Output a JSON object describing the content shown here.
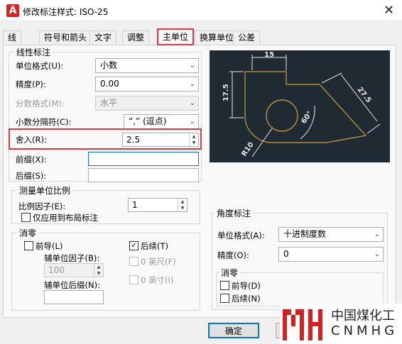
{
  "window": {
    "title": "修改标注样式: ISO-25",
    "app_icon_letter": "A"
  },
  "tabs": [
    "线",
    "符号和箭头",
    "文字",
    "调整",
    "主单位",
    "换算单位",
    "公差"
  ],
  "linear": {
    "group_title": "线性标注",
    "unit_format_label": "单位格式(U):",
    "unit_format_value": "小数",
    "precision_label": "精度(P):",
    "precision_value": "0.00",
    "fraction_format_label": "分数格式(M):",
    "fraction_format_value": "水平",
    "decimal_sep_label": "小数分隔符(C):",
    "decimal_sep_value": "“,” (逗点)",
    "round_off_label": "舍入(R):",
    "round_off_value": "2.5",
    "prefix_label": "前缀(X):",
    "prefix_value": "",
    "suffix_label": "后缀(S):",
    "suffix_value": ""
  },
  "scale": {
    "group_title": "测量单位比例",
    "factor_label": "比例因子(E):",
    "factor_value": "1",
    "layout_only_label": "仅应用到布局标注"
  },
  "zero_suppress": {
    "group_title": "消零",
    "leading_label": "前导(L)",
    "sub_unit_factor_label": "辅单位因子(B):",
    "sub_unit_factor_value": "100",
    "sub_unit_suffix_label": "辅单位后缀(N):",
    "sub_unit_suffix_value": "",
    "trailing_label": "后续(T)",
    "feet_label": "0 英尺(F)",
    "inches_label": "0 英寸(I)"
  },
  "preview": {
    "dim_top": "15",
    "dim_left": "17.5",
    "dim_right": "27.5",
    "dim_angle": "60°",
    "dim_radius": "R10"
  },
  "angular": {
    "group_title": "角度标注",
    "unit_format_label": "单位格式(A):",
    "unit_format_value": "十进制度数",
    "precision_label": "精度(O):",
    "precision_value": "0",
    "zero_group_title": "消零",
    "leading_label": "前导(D)",
    "trailing_label": "后续(N)"
  },
  "buttons": {
    "ok": "确定"
  },
  "watermark": {
    "cn": "中国煤化工",
    "en": "CNMHG"
  },
  "colors": {
    "highlight": "#e0383c",
    "preview_bg": "#1f2a33",
    "preview_line": "#c9a13b"
  }
}
